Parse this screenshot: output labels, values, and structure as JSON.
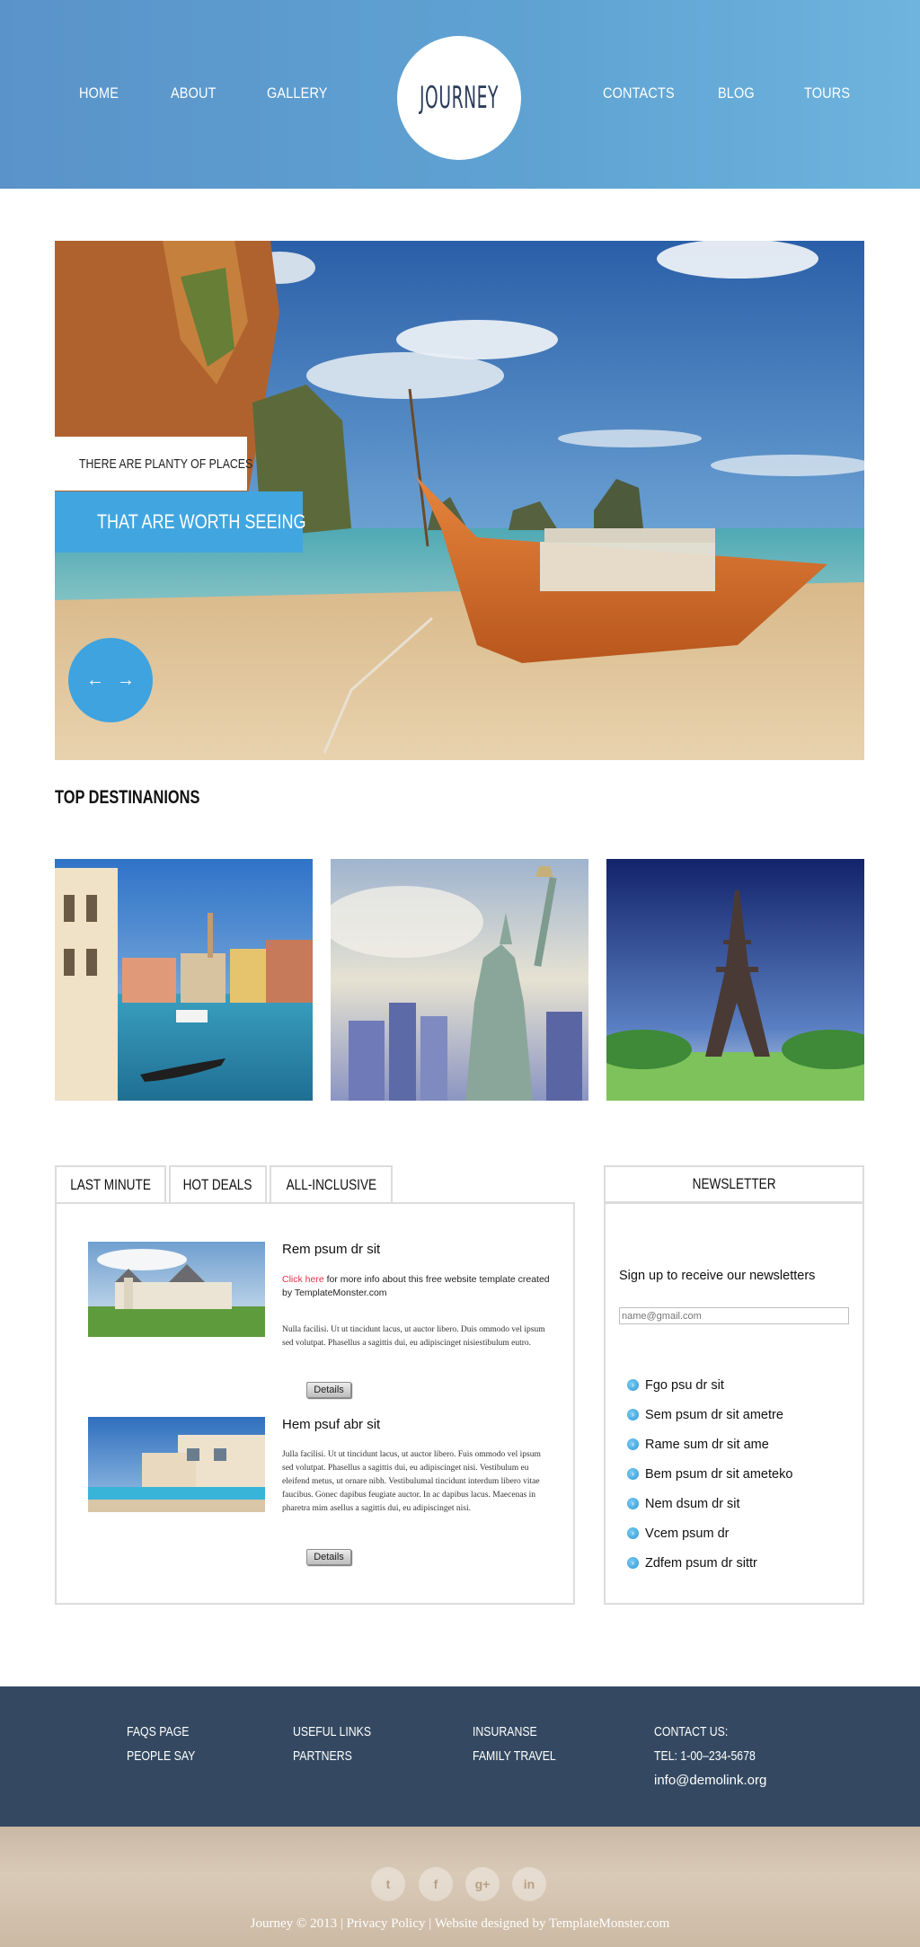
{
  "nav": {
    "home": "HOME",
    "about": "ABOUT",
    "gallery": "GALLERY",
    "contacts": "CONTACTS",
    "blog": "BLOG",
    "tours": "TOURS"
  },
  "logo": "JOURNEY",
  "hero": {
    "caption_small": "THERE ARE PLANTY OF PLACES",
    "caption_big": "THAT ARE WORTH SEEING",
    "prev_icon": "arrow-left-icon",
    "next_icon": "arrow-right-icon"
  },
  "destinations": {
    "title": "TOP DESTINANIONS"
  },
  "tabs": {
    "items": [
      "LAST MINUTE",
      "HOT DEALS",
      "ALL-INCLUSIVE"
    ],
    "deals": [
      {
        "title": "Rem psum dr sit",
        "link_text": "Click here",
        "link_rest": " for more info about this free website template created by TemplateMonster.com",
        "text": "Nulla facilisi. Ut ut tincidunt lacus, ut auctor libero. Duis ommodo vel ipsum sed volutpat. Phasellus a sagittis dui, eu adipiscinget nisiestibulum eutro.",
        "button": "Details"
      },
      {
        "title": "Hem psuf abr sit",
        "text": "Julla facilisi. Ut ut tincidunt lacus, ut auctor libero. Fuis ommodo vel ipsum sed volutpat. Phasellus a sagittis dui, eu adipiscinget nisi. Vestibulum eu eleifend metus, ut ornare nibh. Vestibulumal tincidunt interdum libero vitae faucibus. Gonec dapibus feugiate auctor. In ac dapibus lacus. Maecenas in pharetra mim asellus a sagittis dui, eu adipiscinget nisi.",
        "button": "Details"
      }
    ]
  },
  "newsletter": {
    "title": "NEWSLETTER",
    "signup_text": "Sign up to receive our newsletters",
    "placeholder": "name@gmail.com",
    "items": [
      "Fgo psu dr sit",
      "Sem psum dr sit ametre",
      "Rame sum dr sit ame",
      "Bem psum dr sit ameteko",
      "Nem dsum dr sit",
      "Vcem psum dr",
      "Zdfem psum dr sittr"
    ]
  },
  "footer": {
    "col1": [
      "FAQS PAGE",
      "PEOPLE SAY"
    ],
    "col2": [
      "USEFUL LINKS",
      "PARTNERS"
    ],
    "col3": [
      "INSURANSE",
      "FAMILY TRAVEL"
    ],
    "contact_label": "CONTACT US:",
    "phone": "TEL: 1-00–234-5678",
    "email": "info@demolink.org",
    "social": [
      {
        "name": "twitter-icon",
        "glyph": "t"
      },
      {
        "name": "facebook-icon",
        "glyph": "f"
      },
      {
        "name": "google-plus-icon",
        "glyph": "g+"
      },
      {
        "name": "linkedin-icon",
        "glyph": "in"
      }
    ],
    "copyright_brand": "Journey",
    "copyright_year": " © 2013 | ",
    "privacy": "Privacy Policy",
    "designed_sep": " | Website designed by ",
    "designer": "TemplateMonster.com"
  },
  "colors": {
    "header": "#5fa3d3",
    "accent": "#41a6e0",
    "footer": "#344961",
    "link_red": "#e0334a"
  }
}
